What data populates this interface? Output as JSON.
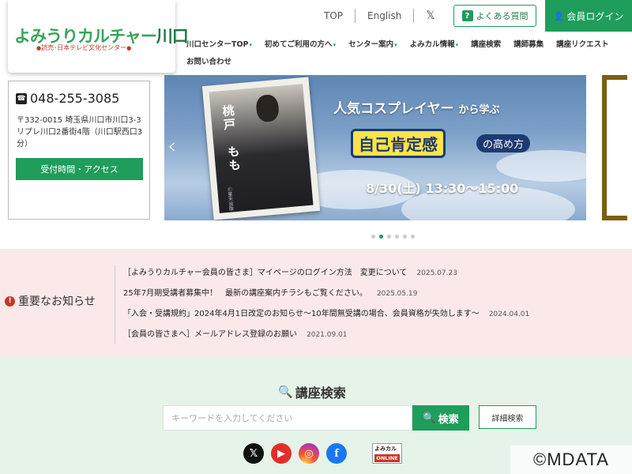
{
  "header": {
    "logo_main": "よみうりカルチャー",
    "logo_place": "川口",
    "logo_sub": "読売･日本テレビ文化センター",
    "top_links": [
      {
        "label": "TOP"
      },
      {
        "label": "English"
      },
      {
        "label": "𝕏"
      }
    ],
    "faq_label": "よくある質問",
    "faq_icon": "?",
    "login_label": "会員ログイン"
  },
  "nav": {
    "items": [
      {
        "label": "川口センターTOP",
        "dropdown": true
      },
      {
        "label": "初めてご利用の方へ",
        "dropdown": true
      },
      {
        "label": "センター案内",
        "dropdown": true
      },
      {
        "label": "よみカル情報",
        "dropdown": true
      },
      {
        "label": "講座検索",
        "dropdown": false
      },
      {
        "label": "講師募集",
        "dropdown": false
      },
      {
        "label": "講座リクエスト",
        "dropdown": false
      },
      {
        "label": "お問い合わせ",
        "dropdown": false
      }
    ]
  },
  "contact": {
    "phone": "048-255-3085",
    "address": "〒332-0015 埼玉県川口市川口3-3 リプレ川口2番街4階（川口駅西口3分）",
    "access_label": "受付時間・アクセス"
  },
  "banner": {
    "name_line1": "桃戸",
    "name_line2": "もも",
    "photo_credit": "Ⓒ星天出版",
    "title_prefix": "人気コスプレイヤー",
    "title_suffix": "から学ぶ",
    "main": "自己肯定感",
    "main_suffix": "の高め方",
    "date": "8/30(土) 13:30〜15:00",
    "slide_count": 6,
    "active_slide": 1
  },
  "notices": {
    "heading": "重要なお知らせ",
    "items": [
      {
        "text": "［よみうりカルチャー会員の皆さま］マイページのログイン方法　変更について",
        "date": "2025.07.23"
      },
      {
        "text": "25年7月期受講者募集中！　最新の講座案内チラシもご覧ください。",
        "date": "2025.05.19"
      },
      {
        "text": "「入会・受講規約」2024年4月1日改定のお知らせ〜10年間無受講の場合、会員資格が失効します〜",
        "date": "2024.04.01"
      },
      {
        "text": "［会員の皆さまへ］メールアドレス登録のお願い",
        "date": "2021.09.01"
      }
    ]
  },
  "search": {
    "title": "講座検索",
    "placeholder": "キーワードを入力してください",
    "button_label": "検索",
    "advanced_label": "詳細検索"
  },
  "social": {
    "x_label": "𝕏",
    "youtube_label": "▶",
    "instagram_label": "◎",
    "facebook_label": "f",
    "online_top": "よみカル",
    "online_bottom": "ONLINE"
  },
  "watermark": "©MDATA",
  "colors": {
    "brand_green": "#1f9d5a",
    "notice_bg": "#fbe9ea",
    "search_bg": "#e6f3e9",
    "alert_red": "#c0392b"
  }
}
